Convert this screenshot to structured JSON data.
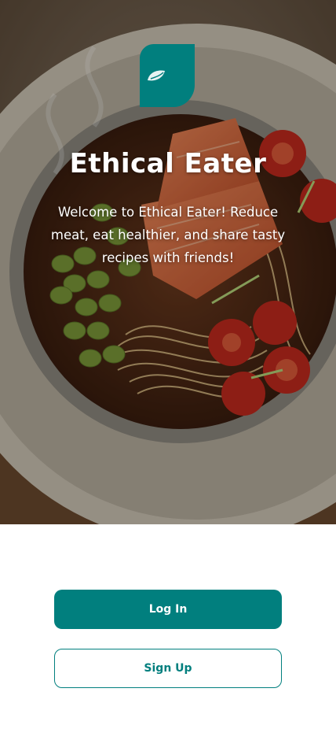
{
  "app": {
    "title": "Ethical Eater",
    "tagline": "Welcome to Ethical Eater! Reduce meat, eat healthier, and share tasty recipes with friends!",
    "logo_icon": "leaf-logo-icon",
    "hero_image": "salmon-noodle-bowl"
  },
  "actions": {
    "login_label": "Log In",
    "signup_label": "Sign Up"
  },
  "colors": {
    "brand": "#017f7e",
    "background": "#ffffff",
    "text_on_image": "#ffffff"
  }
}
